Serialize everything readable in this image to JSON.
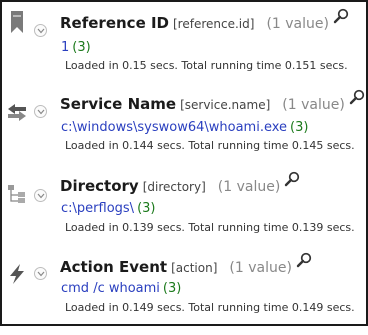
{
  "fields": [
    {
      "name": "Reference ID",
      "key": "[reference.id]",
      "count": "(1 value)",
      "value": "1",
      "value_count": "(3)",
      "timing": "Loaded in 0.15 secs. Total running time 0.151 secs.",
      "icon": "bookmark-icon"
    },
    {
      "name": "Service Name",
      "key": "[service.name]",
      "count": "(1 value)",
      "value": "c:\\windows\\syswow64\\whoami.exe",
      "value_count": "(3)",
      "timing": "Loaded in 0.144 secs. Total running time 0.145 secs.",
      "icon": "exchange-arrows-icon"
    },
    {
      "name": "Directory",
      "key": "[directory]",
      "count": "(1 value)",
      "value": "c:\\perflogs\\",
      "value_count": "(3)",
      "timing": "Loaded in 0.139 secs. Total running time 0.139 secs.",
      "icon": "folder-tree-icon"
    },
    {
      "name": "Action Event",
      "key": "[action]",
      "count": "(1 value)",
      "value": "cmd /c whoami",
      "value_count": "(3)",
      "timing": "Loaded in 0.149 secs. Total running time 0.149 secs.",
      "icon": "lightning-bolt-icon"
    }
  ],
  "colors": {
    "value_link": "#2a3fbf",
    "value_count": "#1c7a1c",
    "muted": "#888888"
  }
}
